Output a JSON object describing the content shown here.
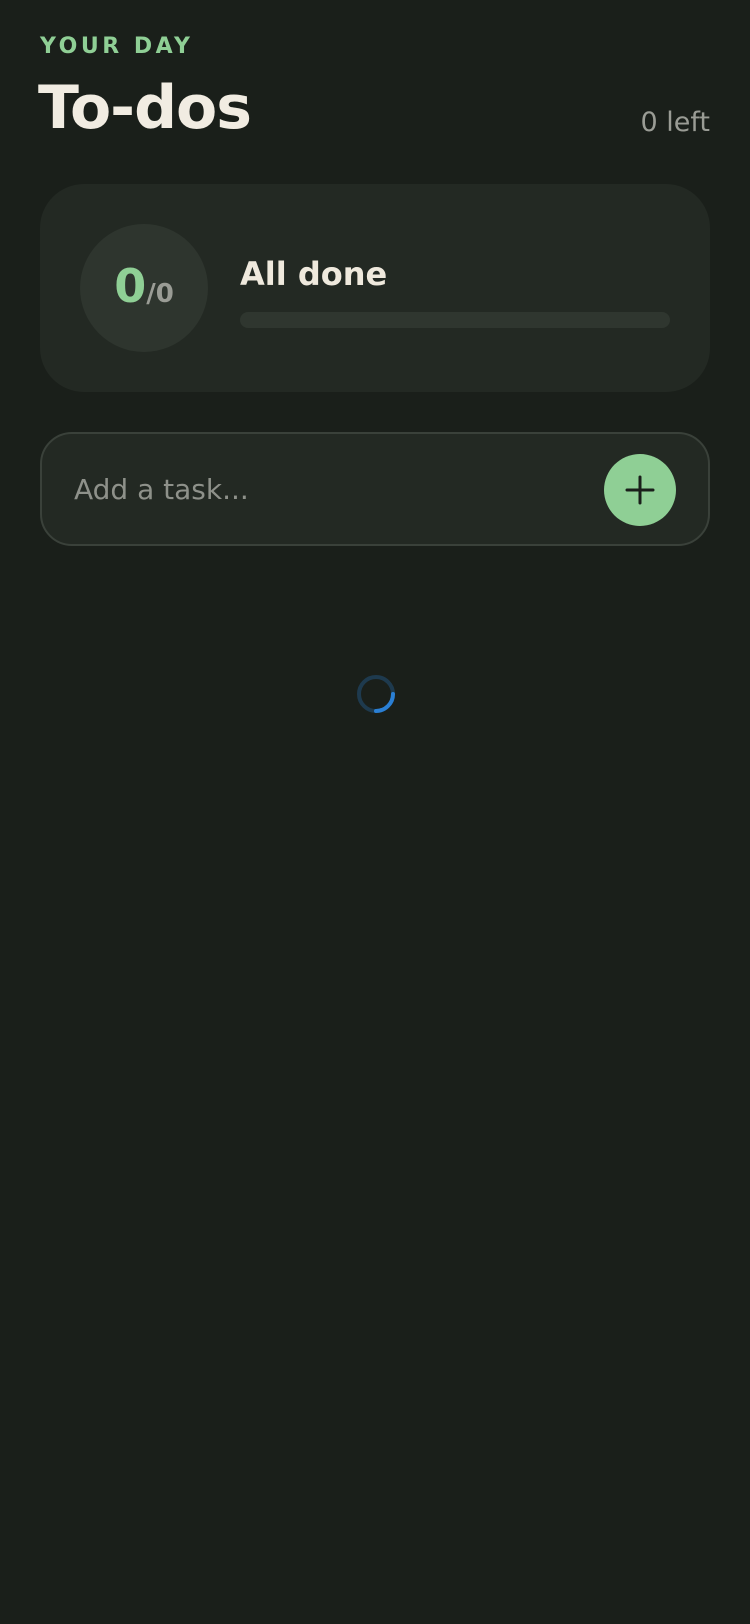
{
  "header": {
    "eyebrow": "YOUR DAY",
    "title": "To-dos",
    "left_count": "0 left"
  },
  "summary": {
    "done": "0",
    "total": "/0",
    "status": "All done",
    "progress_fraction": 0
  },
  "add_task": {
    "placeholder": "Add a task...",
    "value": "",
    "button_icon": "plus-icon"
  },
  "loading": {
    "icon": "loading-spinner-icon"
  },
  "colors": {
    "background": "#1a1f1a",
    "accent": "#8fcf95",
    "card": "#232923",
    "spinner": "#2a7fd4"
  }
}
